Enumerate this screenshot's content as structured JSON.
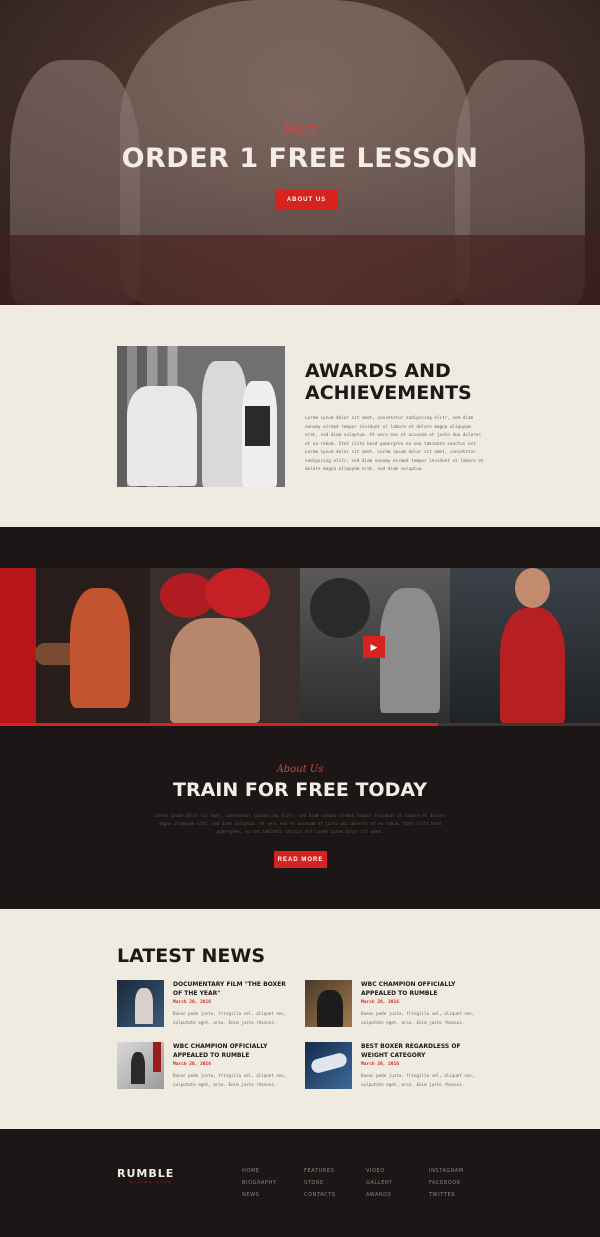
{
  "hero": {
    "script": "Start",
    "title": "ORDER 1 FREE LESSON",
    "button": "ABOUT US"
  },
  "awards": {
    "title_line1": "AWARDS AND",
    "title_line2": "ACHIEVEMENTS",
    "text": "Lorem ipsum dolor sit amet, consetetur sadipscing elitr, sed diam nonumy eirmod tempor invidunt ut labore et dolore magna aliquyam erat, sed diam voluptua. At vero eos et accusam et justo duo dolores et ea rebum. Stet clita kasd gubergren no sea takimata sanctus est Lorem ipsum dolor sit amet. Lorem ipsum dolor sit amet, consetetur sadipscing elitr, sed diam nonumy eirmod tempor invidunt ut labore et dolore magna aliquyam erat, sed diam voluptua."
  },
  "gallery": {
    "progress": 0.73,
    "accent": "#d6231f"
  },
  "train": {
    "script": "About Us",
    "title": "TRAIN FOR FREE TODAY",
    "text": "Lorem ipsum dolor sit amet, consetetur sadipscing elitr, sed diam nonumy eirmod tempor invidunt ut labore et dolore magna aliquyam erat, sed diam voluptua. At vero eos et accusam et justo duo dolores et ea rebum. Stet clita kasd gubergren, no sea takimata sanctus est Lorem ipsum dolor sit amet.",
    "button": "READ MORE"
  },
  "news": {
    "title": "LATEST NEWS",
    "items": [
      {
        "title": "DOCUMENTARY FILM \"THE BOXER OF THE YEAR\"",
        "date": "March 20, 2016",
        "text": "Donec pede justo, fringilla vel, aliquet nec, vulputate eget, arcu. Enim justo rhoncus."
      },
      {
        "title": "WBC CHAMPION OFFICIALLY APPEALED TO RUMBLE",
        "date": "March 20, 2016",
        "text": "Donec pede justo, fringilla vel, aliquet nec, vulputate eget, arcu. Enim justo rhoncus."
      },
      {
        "title": "WBC CHAMPION OFFICIALLY APPEALED TO RUMBLE",
        "date": "March 20, 2016",
        "text": "Donec pede justo, fringilla vel, aliquet nec, vulputate eget, arcu. Enim justo rhoncus."
      },
      {
        "title": "BEST BOXER REGARDLESS OF WEIGHT CATEGORY",
        "date": "March 20, 2016",
        "text": "Donec pede justo, fringilla vel, aliquet nec, vulputate eget, arcu. Enim justo rhoncus."
      }
    ]
  },
  "footer": {
    "logo": "RUMBLE",
    "logo_sub": "BOXING CLUB",
    "columns": [
      [
        "HOME",
        "BIOGRAPHY",
        "NEWS"
      ],
      [
        "FEATURES",
        "STORE",
        "CONTACTS"
      ],
      [
        "VIDEO",
        "GALLERY",
        "AWARDS"
      ],
      [
        "INSTAGRAM",
        "FACEBOOK",
        "TWITTER"
      ]
    ]
  }
}
